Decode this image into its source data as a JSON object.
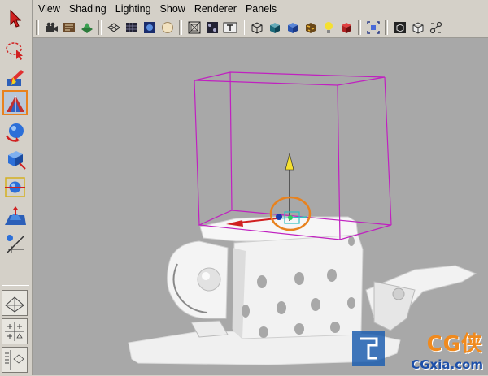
{
  "menubar": {
    "items": [
      {
        "label": "View"
      },
      {
        "label": "Shading"
      },
      {
        "label": "Lighting"
      },
      {
        "label": "Show"
      },
      {
        "label": "Renderer"
      },
      {
        "label": "Panels"
      }
    ]
  },
  "toolbox": {
    "tools": [
      {
        "name": "select-tool-icon",
        "active": false
      },
      {
        "name": "lasso-tool-icon",
        "active": false
      },
      {
        "name": "paint-select-tool-icon",
        "active": false
      },
      {
        "name": "move-tool-icon",
        "active": true
      },
      {
        "name": "rotate-tool-icon",
        "active": false
      },
      {
        "name": "scale-tool-icon",
        "active": false
      },
      {
        "name": "universal-manipulator-icon",
        "active": false
      },
      {
        "name": "soft-modification-icon",
        "active": false
      },
      {
        "name": "show-manipulator-icon",
        "active": false
      }
    ]
  },
  "viewport": {
    "background_color": "#a8a8a8",
    "bounding_box_color": "#c020c0",
    "highlight_circle_color": "#e8821e"
  },
  "watermark": {
    "logo": "CG侠",
    "url": "CGxia.com"
  }
}
